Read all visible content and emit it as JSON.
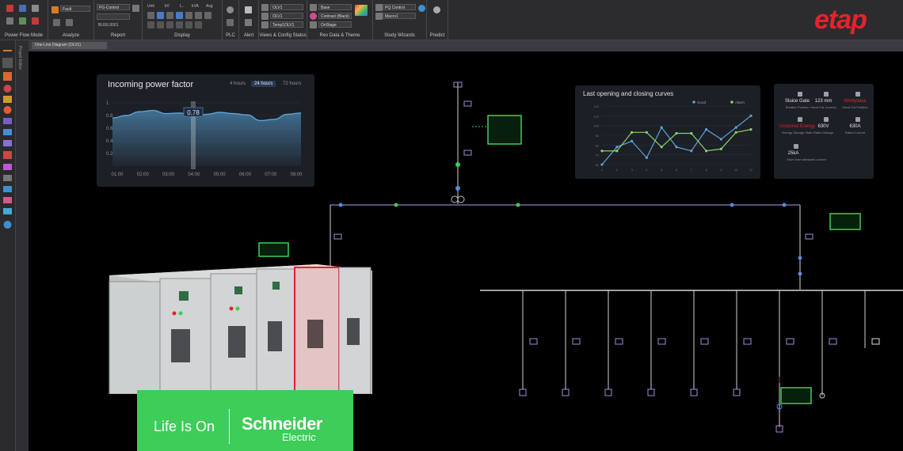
{
  "ribbon": {
    "groups": [
      {
        "label": "Power Flow Mode"
      },
      {
        "label": "Analyze"
      },
      {
        "label": "Report"
      },
      {
        "label": "Display"
      },
      {
        "label": "PLC"
      },
      {
        "label": "Alert"
      },
      {
        "label": "Views & Config Status"
      },
      {
        "label": "Rev Data & Theme"
      },
      {
        "label": "Study Wizards"
      },
      {
        "label": "Predict"
      }
    ],
    "dropdowns": {
      "analyze_case": "Fault",
      "report_study": "PG-Control",
      "report_output": "BUS0.0001",
      "view1": "OLV1",
      "view2": "OLV1",
      "config": "Temp1OLV1",
      "revision": "Base",
      "theme": "Contrast (Black)",
      "template": "OnStage",
      "wizard1": "PQ Control",
      "wizard2": "Macro1"
    },
    "display_buttons": [
      "Unit",
      "kV",
      "L..",
      "kVA",
      "Avg"
    ]
  },
  "brand": {
    "logo_text": "etap",
    "accent": "#e8212b"
  },
  "document_tab": "One-Line Diagram (OLV1)",
  "left_panel_label": "Project Editor",
  "power_factor_card": {
    "title": "Incoming power factor",
    "tabs": [
      "4 hours",
      "24 hours",
      "72 hours"
    ],
    "active_tab": "24 hours",
    "cursor_value": "0.78",
    "y_ticks": [
      "1",
      "0.8",
      "0.6",
      "0.4",
      "0.2"
    ],
    "x_ticks": [
      "01:00",
      "02:00",
      "03:00",
      "04:00",
      "05:00",
      "06:00",
      "07:00",
      "08:00"
    ]
  },
  "curves_card": {
    "title": "Last opening and closing curves",
    "legend": [
      "Good",
      "Alarm"
    ]
  },
  "stats_card": {
    "items": [
      {
        "value": "Sluice Gate",
        "label": "Breaker Position",
        "color": "#e2e2e2"
      },
      {
        "value": "123 mm",
        "label": "Hand Cat Journey",
        "color": "#e2e2e2"
      },
      {
        "value": "Workplace",
        "label": "Hand Cat Position",
        "color": "#e8212b"
      },
      {
        "value": "Unstored Energy",
        "label": "Energy Storage State",
        "color": "#e8212b"
      },
      {
        "value": "630V",
        "label": "Rated Voltage",
        "color": "#e2e2e2"
      },
      {
        "value": "630A",
        "label": "Rated Current",
        "color": "#e2e2e2"
      },
      {
        "value": "25kA",
        "label": "Short time withstand current",
        "color": "#e2e2e2"
      }
    ]
  },
  "banner": {
    "slogan": "Life Is On",
    "brand": "Schneider",
    "brand_sub": "Electric",
    "color": "#3dcd58"
  },
  "colors": {
    "bus": "#8e7cc3",
    "wire": "#d6d6d6",
    "node_green": "#3dcd58",
    "node_blue": "#5a8bd6",
    "chart_line": "#5ba3d9"
  },
  "chart_data": [
    {
      "type": "area",
      "title": "Incoming power factor",
      "x": [
        "01:00",
        "",
        "02:00",
        "",
        "03:00",
        "",
        "04:00",
        "",
        "05:00",
        "",
        "06:00",
        "",
        "07:00",
        "",
        "08:00"
      ],
      "series": [
        {
          "values": [
            0.76,
            0.8,
            0.86,
            0.88,
            0.83,
            0.84,
            0.79,
            0.82,
            0.85,
            0.83,
            0.81,
            0.72,
            0.74,
            0.82,
            0.84
          ]
        }
      ],
      "ylim": [
        0,
        1
      ]
    },
    {
      "type": "line",
      "title": "Last opening and closing curves",
      "categories": [
        "1",
        "2",
        "3",
        "4",
        "5",
        "6",
        "7",
        "8",
        "9",
        "10",
        "11"
      ],
      "series": [
        {
          "name": "Good",
          "values": [
            60,
            78,
            84,
            67,
            98,
            78,
            74,
            96,
            86,
            98,
            110
          ]
        },
        {
          "name": "Alarm",
          "values": [
            74,
            74,
            93,
            93,
            78,
            92,
            92,
            74,
            76,
            93,
            96
          ]
        }
      ],
      "ylim": [
        60,
        120
      ]
    }
  ]
}
